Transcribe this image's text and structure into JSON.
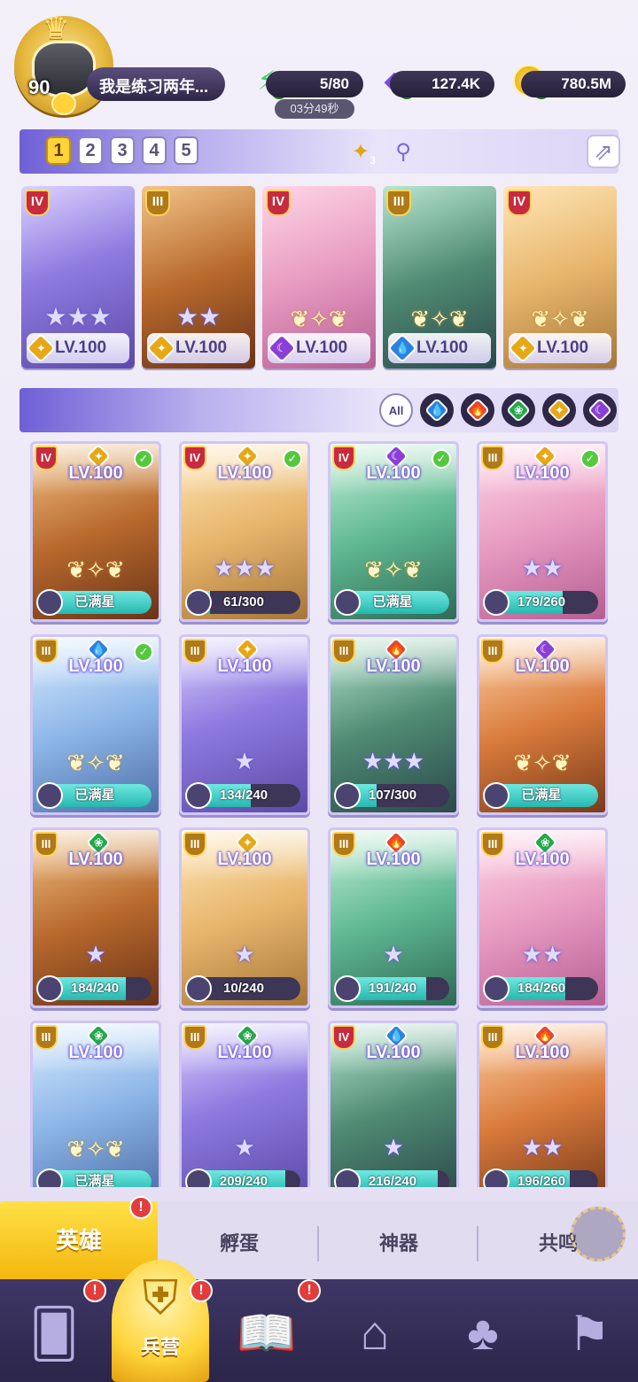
{
  "player": {
    "level": "90",
    "name": "我是练习两年..."
  },
  "resources": {
    "energy": "5/80",
    "energy_timer": "03分49秒",
    "gems": "127.4K",
    "gold": "780.5M"
  },
  "formation": {
    "slots": [
      "1",
      "2",
      "3",
      "4",
      "5"
    ],
    "active_slot": "1",
    "element_badge": "3",
    "team": [
      {
        "tier": "IV",
        "element": "light",
        "level": "LV.100",
        "stars": "★★★",
        "winged": false
      },
      {
        "tier": "III",
        "element": "light",
        "level": "LV.100",
        "stars": "★★",
        "winged": false
      },
      {
        "tier": "IV",
        "element": "dark",
        "level": "LV.100",
        "stars": "",
        "winged": true
      },
      {
        "tier": "III",
        "element": "water",
        "level": "LV.100",
        "stars": "",
        "winged": true
      },
      {
        "tier": "IV",
        "element": "light",
        "level": "LV.100",
        "stars": "",
        "winged": true
      }
    ]
  },
  "filters": {
    "all_label": "All",
    "elements": [
      "water",
      "fire",
      "nature",
      "light",
      "dark"
    ]
  },
  "heroes": [
    {
      "tier": "IV",
      "element": "light",
      "level": "LV.100",
      "check": true,
      "stars": "",
      "winged": true,
      "shards": "已满星",
      "progress": 1.0
    },
    {
      "tier": "IV",
      "element": "light",
      "level": "LV.100",
      "check": true,
      "stars": "★★★",
      "winged": false,
      "shards": "61/300",
      "progress": 0.2
    },
    {
      "tier": "IV",
      "element": "dark",
      "level": "LV.100",
      "check": true,
      "stars": "",
      "winged": true,
      "shards": "已满星",
      "progress": 1.0
    },
    {
      "tier": "III",
      "element": "light",
      "level": "LV.100",
      "check": true,
      "stars": "★★",
      "winged": false,
      "shards": "179/260",
      "progress": 0.69
    },
    {
      "tier": "III",
      "element": "water",
      "level": "LV.100",
      "check": true,
      "stars": "",
      "winged": true,
      "shards": "已满星",
      "progress": 1.0
    },
    {
      "tier": "III",
      "element": "light",
      "level": "LV.100",
      "check": false,
      "stars": "★",
      "winged": false,
      "shards": "134/240",
      "progress": 0.56
    },
    {
      "tier": "III",
      "element": "fire",
      "level": "LV.100",
      "check": false,
      "stars": "★★★",
      "winged": false,
      "shards": "107/300",
      "progress": 0.36
    },
    {
      "tier": "III",
      "element": "dark",
      "level": "LV.100",
      "check": false,
      "stars": "",
      "winged": true,
      "shards": "已满星",
      "progress": 1.0
    },
    {
      "tier": "III",
      "element": "nature",
      "level": "LV.100",
      "check": false,
      "stars": "★",
      "winged": false,
      "shards": "184/240",
      "progress": 0.77
    },
    {
      "tier": "III",
      "element": "light",
      "level": "LV.100",
      "check": false,
      "stars": "★",
      "winged": false,
      "shards": "10/240",
      "progress": 0.04
    },
    {
      "tier": "III",
      "element": "fire",
      "level": "LV.100",
      "check": false,
      "stars": "★",
      "winged": false,
      "shards": "191/240",
      "progress": 0.8
    },
    {
      "tier": "III",
      "element": "nature",
      "level": "LV.100",
      "check": false,
      "stars": "★★",
      "winged": false,
      "shards": "184/260",
      "progress": 0.71
    },
    {
      "tier": "III",
      "element": "nature",
      "level": "LV.100",
      "check": false,
      "stars": "",
      "winged": true,
      "shards": "已满星",
      "progress": 1.0
    },
    {
      "tier": "III",
      "element": "nature",
      "level": "LV.100",
      "check": false,
      "stars": "★",
      "winged": false,
      "shards": "209/240",
      "progress": 0.87
    },
    {
      "tier": "IV",
      "element": "water",
      "level": "LV.100",
      "check": false,
      "stars": "★",
      "winged": false,
      "shards": "216/240",
      "progress": 0.9
    },
    {
      "tier": "III",
      "element": "fire",
      "level": "LV.100",
      "check": false,
      "stars": "★★",
      "winged": false,
      "shards": "196/260",
      "progress": 0.75
    }
  ],
  "subtabs": [
    "英雄",
    "孵蛋",
    "神器",
    "共鸣"
  ],
  "bottom_nav": {
    "active_label": "兵营",
    "items": [
      "cards-icon",
      "barracks-icon",
      "map-book-icon",
      "castle-icon",
      "mushroom-house-icon",
      "guild-banner-icon"
    ]
  },
  "colors": {
    "light": "#e6a817",
    "dark": "#8b3fd6",
    "water": "#2c82e0",
    "fire": "#e8462c",
    "nature": "#23a84a",
    "accent_yellow": "#ffd33a",
    "nav_bg": "#2b2549"
  }
}
